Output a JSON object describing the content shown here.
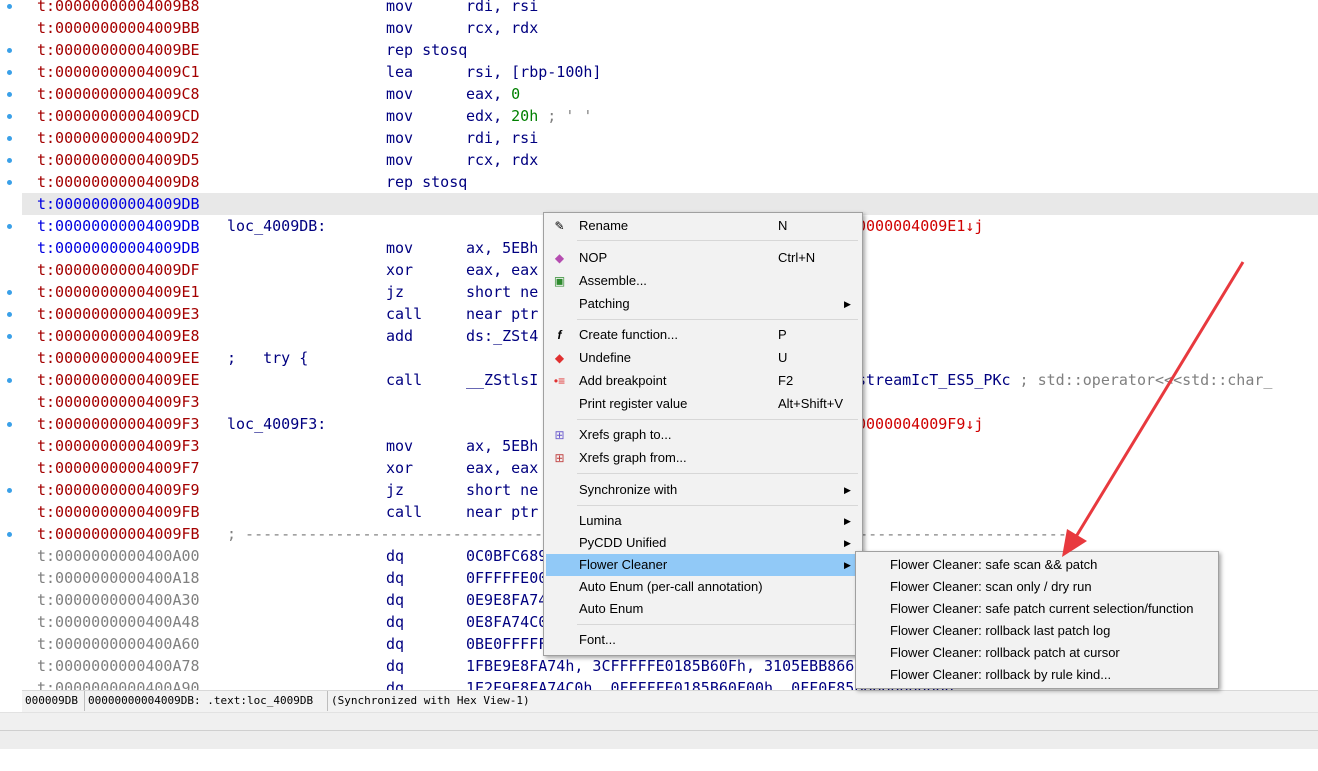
{
  "listing": [
    {
      "addr": "t:00000000004009B8",
      "mn": "mov",
      "op": "rdi, rsi"
    },
    {
      "addr": "t:00000000004009BB",
      "mn": "mov",
      "op": "rcx, rdx"
    },
    {
      "addr": "t:00000000004009BE",
      "mn": "rep stosq"
    },
    {
      "addr": "t:00000000004009C1",
      "mn": "lea",
      "op": "rsi, [rbp-100h]"
    },
    {
      "addr": "t:00000000004009C8",
      "mn": "mov",
      "op": "eax, ",
      "num": "0"
    },
    {
      "addr": "t:00000000004009CD",
      "mn": "mov",
      "op": "edx, ",
      "num": "20h",
      "cmt": " ; ' '"
    },
    {
      "addr": "t:00000000004009D2",
      "mn": "mov",
      "op": "rdi, rsi"
    },
    {
      "addr": "t:00000000004009D5",
      "mn": "mov",
      "op": "rcx, rdx"
    },
    {
      "addr": "t:00000000004009D8",
      "mn": "rep stosq"
    },
    {
      "addr": "t:00000000004009DB",
      "cur": true,
      "hl": true
    },
    {
      "addr": "t:00000000004009DB",
      "cur": true,
      "lbl": "loc_4009DB:",
      "xref": "0000004009E1↓j"
    },
    {
      "addr": "t:00000000004009DB",
      "cur": true,
      "mn": "mov",
      "op": "ax, 5EBh"
    },
    {
      "addr": "t:00000000004009DF",
      "mn": "xor",
      "op": "eax, eax"
    },
    {
      "addr": "t:00000000004009E1",
      "mn": "jz",
      "op": "short ne"
    },
    {
      "addr": "t:00000000004009E3",
      "mn": "call",
      "op": "near ptr"
    },
    {
      "addr": "t:00000000004009E8",
      "mn": "add",
      "op": "ds:_ZSt4"
    },
    {
      "addr": "t:00000000004009EE",
      "lbl": ";   try {"
    },
    {
      "addr": "t:00000000004009EE",
      "mn": "call",
      "op": "__ZStlsI",
      "op2": "streamIcT_ES5_PKc",
      "cmt2": " ; std::operator<<<std::char_"
    },
    {
      "addr": "t:00000000004009F3"
    },
    {
      "addr": "t:00000000004009F3",
      "lbl": "loc_4009F3:",
      "xref": "0000004009F9↓j"
    },
    {
      "addr": "t:00000000004009F3",
      "mn": "mov",
      "op": "ax, 5EBh"
    },
    {
      "addr": "t:00000000004009F7",
      "mn": "xor",
      "op": "eax, eax"
    },
    {
      "addr": "t:00000000004009F9",
      "mn": "jz",
      "op": "short ne"
    },
    {
      "addr": "t:00000000004009FB",
      "mn": "call",
      "op": "near ptr"
    },
    {
      "addr": "t:00000000004009FB",
      "dash": "; --------------------------------------------------------------------------------------------"
    },
    {
      "addr": "t:0000000000400A00",
      "gray": true,
      "mn": "dq",
      "op": "0C0BFC68948FF"
    },
    {
      "addr": "t:0000000000400A18",
      "gray": true,
      "mn": "dq",
      "op": "0FFFFFE00858D"
    },
    {
      "addr": "t:0000000000400A30",
      "gray": true,
      "mn": "dq",
      "op": "0E9E8FA74C031"
    },
    {
      "addr": "t:0000000000400A48",
      "gray": true,
      "mn": "dq",
      "op": "0E8FA74C03105"
    },
    {
      "addr": "t:0000000000400A60",
      "gray": true,
      "mn": "dq",
      "op": "0BE0FFFFFFE0F"
    },
    {
      "addr": "t:0000000000400A78",
      "gray": true,
      "mn": "dq",
      "op": "1FBE9E8FA74h, 3CFFFFFE0185B60Fh, 3105EBB8660"
    },
    {
      "addr": "t:0000000000400A90",
      "gray": true,
      "mn": "dq",
      "op": "1E2E9E8FA74C0h, 0FFFFFE0185B60F00h, 0FF0F85B8660000000"
    }
  ],
  "gutter_dots": [
    0,
    2,
    3,
    4,
    5,
    6,
    7,
    8,
    10,
    13,
    14,
    15,
    17,
    19,
    22,
    24
  ],
  "status": {
    "offset": "000009DB",
    "location": "00000000004009DB: .text:loc_4009DB",
    "sync": "(Synchronized with Hex View-1)"
  },
  "menu": {
    "items": [
      {
        "icon": "rename-icon",
        "label": "Rename",
        "key": "N"
      },
      {
        "icon": "nop-icon",
        "label": "NOP",
        "key": "Ctrl+N"
      },
      {
        "icon": "assemble-icon",
        "label": "Assemble..."
      },
      {
        "label": "Patching",
        "arrow": "▶"
      },
      {
        "icon": "function-icon",
        "label": "Create function...",
        "key": "P"
      },
      {
        "icon": "undefine-icon",
        "label": "Undefine",
        "key": "U"
      },
      {
        "icon": "breakpoint-icon",
        "label": "Add breakpoint",
        "key": "F2"
      },
      {
        "label": "Print register value",
        "key": "Alt+Shift+V"
      },
      {
        "icon": "xrefs-to-icon",
        "label": "Xrefs graph to..."
      },
      {
        "icon": "xrefs-from-icon",
        "label": "Xrefs graph from..."
      },
      {
        "label": "Synchronize with",
        "arrow": "▶"
      },
      {
        "label": "Lumina",
        "arrow": "▶"
      },
      {
        "label": "PyCDD Unified",
        "arrow": "▶"
      },
      {
        "label": "Flower Cleaner",
        "arrow": "▶",
        "selected": true
      },
      {
        "label": "Auto Enum (per-call annotation)"
      },
      {
        "label": "Auto Enum"
      },
      {
        "label": "Font..."
      }
    ]
  },
  "submenu": {
    "items": [
      "Flower Cleaner: safe scan && patch",
      "Flower Cleaner: scan only / dry run",
      "Flower Cleaner: safe patch current selection/function",
      "Flower Cleaner: rollback last patch log",
      "Flower Cleaner: rollback patch at cursor",
      "Flower Cleaner: rollback by rule kind..."
    ]
  },
  "annotation": {
    "arrow_color": "#e8393e"
  }
}
